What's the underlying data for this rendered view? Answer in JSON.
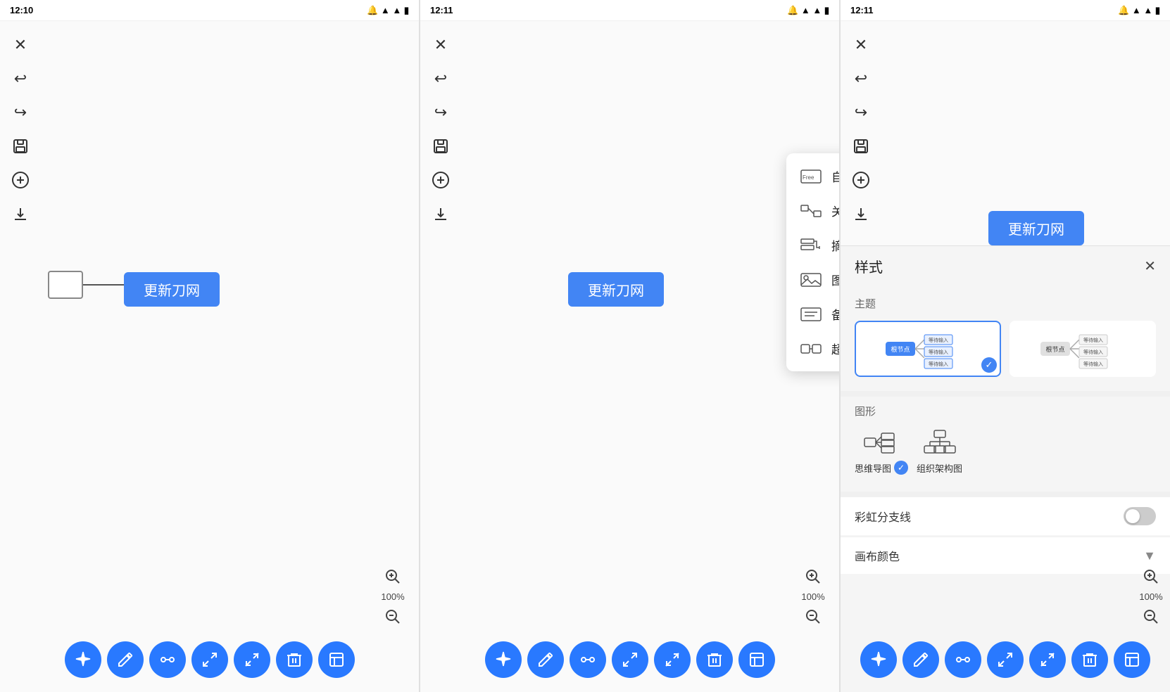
{
  "panels": [
    {
      "id": "panel1",
      "time": "12:10",
      "toolbar": {
        "buttons": [
          {
            "name": "close",
            "icon": "✕"
          },
          {
            "name": "undo",
            "icon": "↩"
          },
          {
            "name": "redo",
            "icon": "↪"
          },
          {
            "name": "save",
            "icon": "💾"
          },
          {
            "name": "add",
            "icon": "⊕"
          },
          {
            "name": "download",
            "icon": "⬇"
          }
        ]
      },
      "canvas": {
        "node_empty_label": "",
        "node_root_label": "更新刀网"
      },
      "zoom": {
        "in": "+",
        "level": "100%",
        "out": "−"
      },
      "bottom_buttons": [
        "✦",
        "✏",
        "↔",
        "⤢",
        "⤡",
        "🗑",
        "⊟"
      ]
    },
    {
      "id": "panel2",
      "time": "12:11",
      "toolbar": {
        "buttons": [
          {
            "name": "close",
            "icon": "✕"
          },
          {
            "name": "undo",
            "icon": "↩"
          },
          {
            "name": "redo",
            "icon": "↪"
          },
          {
            "name": "save",
            "icon": "💾"
          },
          {
            "name": "add",
            "icon": "⊕"
          },
          {
            "name": "download",
            "icon": "⬇"
          }
        ]
      },
      "canvas": {
        "node_root_label": "更新刀网"
      },
      "dropdown": {
        "items": [
          {
            "icon": "free",
            "label": "自由节点"
          },
          {
            "icon": "link",
            "label": "关联线"
          },
          {
            "icon": "summary",
            "label": "摘要"
          },
          {
            "icon": "image",
            "label": "图片"
          },
          {
            "icon": "note",
            "label": "备注"
          },
          {
            "icon": "hyperlink",
            "label": "超链接"
          }
        ]
      },
      "zoom": {
        "in": "+",
        "level": "100%",
        "out": "−"
      },
      "bottom_buttons": [
        "✦",
        "✏",
        "↔",
        "⤢",
        "⤡",
        "🗑",
        "⊟"
      ]
    },
    {
      "id": "panel3",
      "time": "12:11",
      "toolbar": {
        "buttons": [
          {
            "name": "close",
            "icon": "✕"
          },
          {
            "name": "undo",
            "icon": "↩"
          },
          {
            "name": "redo",
            "icon": "↪"
          },
          {
            "name": "save",
            "icon": "💾"
          },
          {
            "name": "add",
            "icon": "⊕"
          },
          {
            "name": "download",
            "icon": "⬇"
          }
        ]
      },
      "canvas": {
        "node_root_label": "更新刀网"
      },
      "style_panel": {
        "title": "样式",
        "theme_label": "主题",
        "shape_label": "图形",
        "shapes": [
          {
            "name": "思维导图",
            "selected": true
          },
          {
            "name": "组织架构图",
            "selected": false
          }
        ],
        "rainbow_label": "彩虹分支线",
        "rainbow_on": false,
        "canvas_color_label": "画布颜色"
      },
      "zoom": {
        "in": "+",
        "level": "100%",
        "out": "−"
      },
      "bottom_buttons": [
        "✦",
        "✏",
        "↔",
        "⤢",
        "⤡",
        "🗑",
        "⊟"
      ]
    }
  ]
}
